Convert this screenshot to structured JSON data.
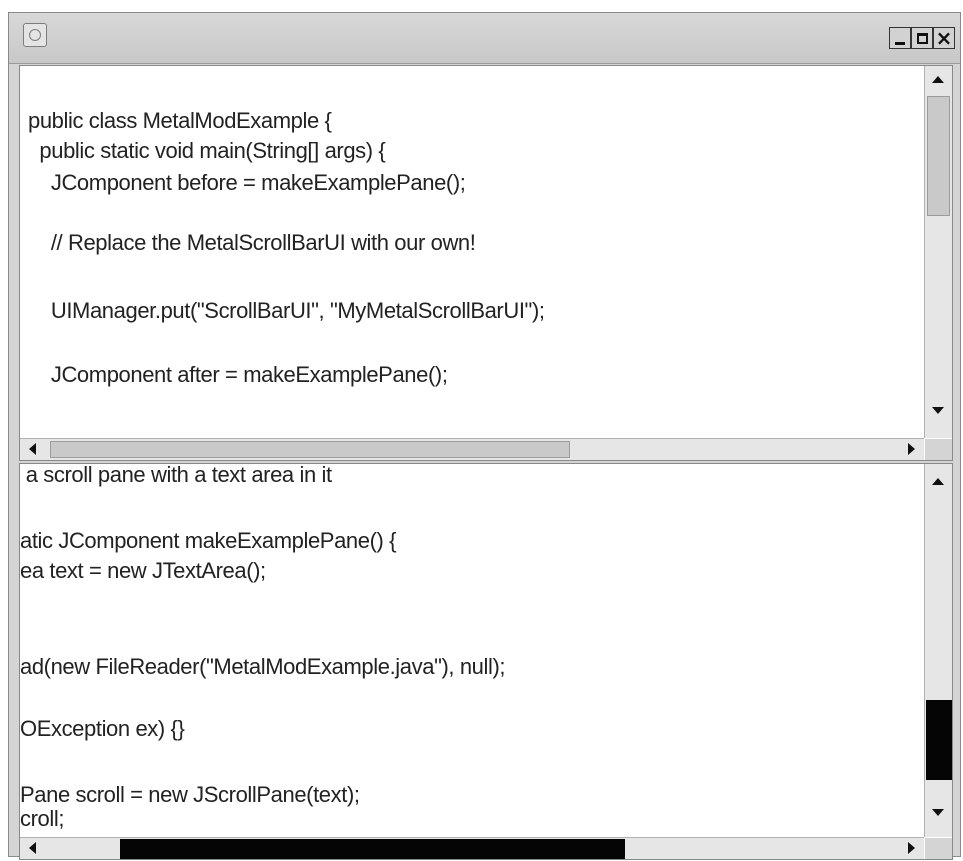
{
  "window": {
    "controls": {
      "minimize": "_",
      "maximize": "□",
      "close": "×"
    },
    "app_icon": "window-icon"
  },
  "top_pane": {
    "lines": [
      "public class MetalModExample {",
      "  public static void main(String[] args) {",
      "    JComponent before = makeExamplePane();",
      "    // Replace the MetalScrollBarUI with our own!",
      "    UIManager.put(\"ScrollBarUI\", \"MyMetalScrollBarUI\");",
      "    JComponent after = makeExamplePane();"
    ],
    "scrollbar_style": "metal-default"
  },
  "bottom_pane": {
    "lines": [
      " a scroll pane with a text area in it",
      "atic JComponent makeExamplePane() {",
      "ea text = new JTextArea();",
      "ad(new FileReader(\"MetalModExample.java\"), null);",
      "OException ex) {}",
      "Pane scroll = new JScrollPane(text);",
      "croll;"
    ],
    "scrollbar_style": "custom-black-thumb"
  },
  "colors": {
    "custom_thumb": "#050505",
    "default_thumb": "#c9c9c9"
  }
}
